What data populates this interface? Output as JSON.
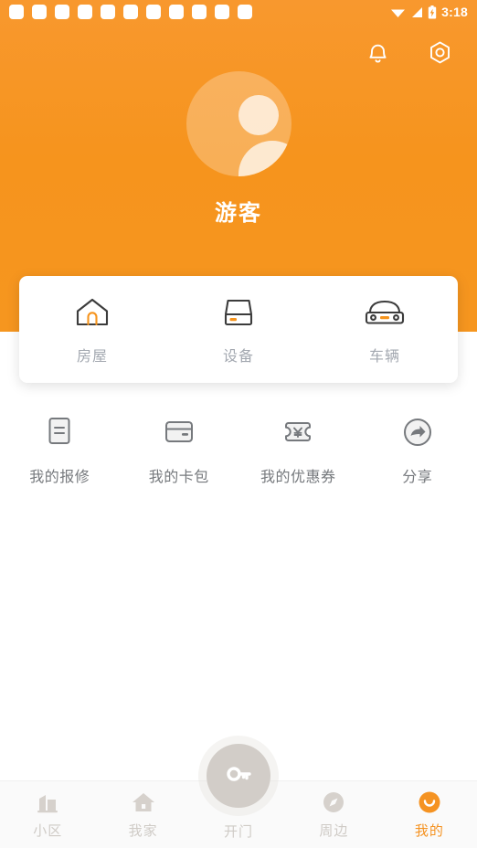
{
  "status_bar": {
    "notification_dot_count": 11,
    "wifi_icon": "wifi-icon",
    "signal_icon": "signal-icon",
    "battery_icon": "battery-charging-icon",
    "time": "3:18"
  },
  "header": {
    "background_color": "#f6941d",
    "actions": [
      {
        "name": "notification-bell-button",
        "icon": "bell-icon"
      },
      {
        "name": "settings-button",
        "icon": "hexagon-gear-icon"
      }
    ],
    "avatar": {
      "icon": "default-user-avatar-icon"
    },
    "username": "游客"
  },
  "asset_card": {
    "items": [
      {
        "icon": "house-icon",
        "label": "房屋"
      },
      {
        "icon": "device-icon",
        "label": "设备"
      },
      {
        "icon": "car-icon",
        "label": "车辆"
      }
    ]
  },
  "quick_grid": {
    "items": [
      {
        "icon": "repair-document-icon",
        "label": "我的报修"
      },
      {
        "icon": "card-wallet-icon",
        "label": "我的卡包"
      },
      {
        "icon": "coupon-yuan-icon",
        "label": "我的优惠券"
      },
      {
        "icon": "share-arrow-icon",
        "label": "分享"
      }
    ]
  },
  "bottom_nav": {
    "active_color": "#f59322",
    "inactive_color": "#cfcbc6",
    "items": [
      {
        "icon": "buildings-icon",
        "label": "小区",
        "active": false
      },
      {
        "icon": "home-icon",
        "label": "我家",
        "active": false
      },
      {
        "icon": "key-icon",
        "label": "开门",
        "active": false
      },
      {
        "icon": "compass-icon",
        "label": "周边",
        "active": false
      },
      {
        "icon": "smiley-face-icon",
        "label": "我的",
        "active": true
      }
    ],
    "fab": {
      "icon": "key-icon",
      "label": "开门"
    }
  }
}
